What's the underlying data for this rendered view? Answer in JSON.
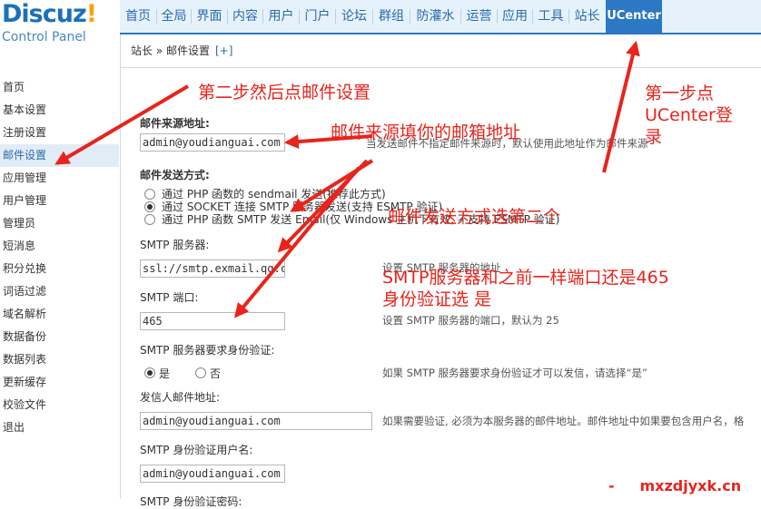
{
  "logo": {
    "brand_main": "Discuz",
    "brand_mark": "!",
    "subtitle": "Control Panel"
  },
  "topnav": [
    "首页",
    "全局",
    "界面",
    "内容",
    "用户",
    "门户",
    "论坛",
    "群组",
    "防灌水",
    "运营",
    "应用",
    "工具",
    "站长",
    "UCenter"
  ],
  "breadcrumb": {
    "text": "站长 » 邮件设置",
    "plus": "[+]"
  },
  "sidebar": [
    "首页",
    "基本设置",
    "注册设置",
    "邮件设置",
    "应用管理",
    "用户管理",
    "管理员",
    "短消息",
    "积分兑换",
    "词语过滤",
    "域名解析",
    "数据备份",
    "数据列表",
    "更新缓存",
    "校验文件",
    "退出"
  ],
  "form": {
    "from_label": "邮件来源地址:",
    "from_value": "admin@youdianguai.com",
    "from_tip": "当发送邮件不指定邮件来源时，默认使用此地址作为邮件来源",
    "method_label": "邮件发送方式:",
    "method_options": [
      "通过 PHP 函数的 sendmail 发送(推荐此方式)",
      "通过 SOCKET 连接 SMTP 服务器发送(支持 ESMTP 验证)",
      "通过 PHP 函数 SMTP 发送 Email(仅 Windows 主机下有效, 不支持 ESMTP 验证)"
    ],
    "smtp_server_label": "SMTP 服务器:",
    "smtp_server_value": "ssl://smtp.exmail.qq.com",
    "smtp_server_tip": "设置 SMTP 服务器的地址",
    "smtp_port_label": "SMTP 端口:",
    "smtp_port_value": "465",
    "smtp_port_tip": "设置 SMTP 服务器的端口，默认为 25",
    "auth_label": "SMTP 服务器要求身份验证:",
    "auth_yes": "是",
    "auth_no": "否",
    "auth_tip": "如果 SMTP 服务器要求身份验证才可以发信，请选择“是”",
    "sender_label": "发信人邮件地址:",
    "sender_value": "admin@youdianguai.com",
    "sender_tip": "如果需要验证, 必须为本服务器的邮件地址。邮件地址中如果要包含用户名，格",
    "user_label": "SMTP 身份验证用户名:",
    "user_value": "admin@youdianguai.com",
    "pass_label": "SMTP 身份验证密码:"
  },
  "annotations": {
    "step1": [
      "第一步点",
      "UCenter登",
      "录"
    ],
    "step2": "第二步然后点邮件设置",
    "from_hint": "邮件来源填你的邮箱地址",
    "method_hint": "邮件发送方式选第二个",
    "smtp_hint": [
      "SMTP服务器和之前一样端口还是465",
      "身份验证选 是"
    ],
    "watermark": "-     mxzdjyxk.cn"
  },
  "colors": {
    "accent": "#2c78c4",
    "annotation": "#e8241c"
  }
}
